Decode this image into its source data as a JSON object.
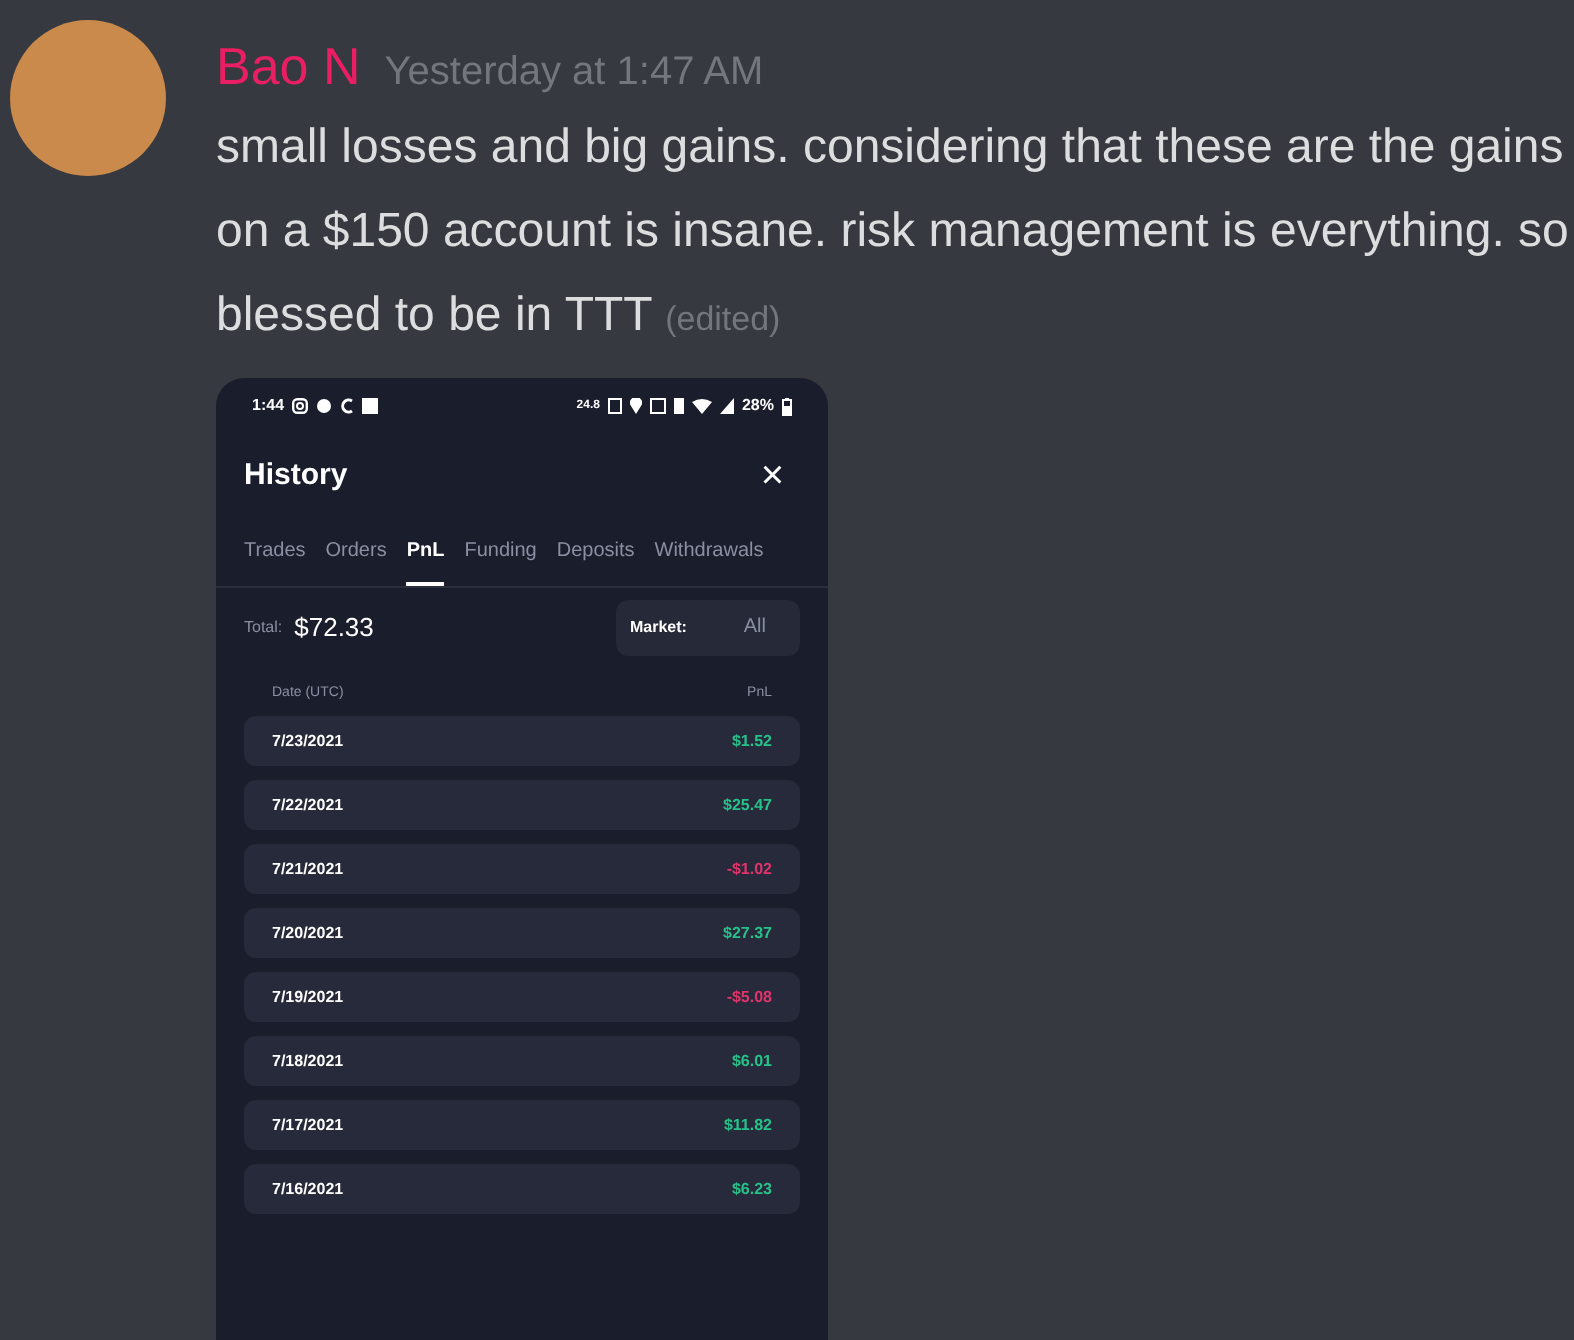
{
  "message": {
    "author": "Bao N",
    "timestamp": "Yesterday at 1:47 AM",
    "text": "small losses and big gains. considering that these are the gains on a $150 account is insane. risk management is everything. so blessed to be in TTT",
    "edited_label": "(edited)"
  },
  "attachment": {
    "status_bar": {
      "time": "1:44",
      "speed": "24.8",
      "battery": "28%"
    },
    "title": "History",
    "close": "×",
    "tabs": [
      {
        "label": "Trades",
        "selected": false
      },
      {
        "label": "Orders",
        "selected": false
      },
      {
        "label": "PnL",
        "selected": true
      },
      {
        "label": "Funding",
        "selected": false
      },
      {
        "label": "Deposits",
        "selected": false
      },
      {
        "label": "Withdrawals",
        "selected": false
      }
    ],
    "total_label": "Total:",
    "total_value": "$72.33",
    "market_label": "Market:",
    "market_value": "All",
    "columns": [
      "Date (UTC)",
      "PnL"
    ],
    "rows": [
      {
        "date": "7/23/2021",
        "pnl": "$1.52",
        "kind": "gain"
      },
      {
        "date": "7/22/2021",
        "pnl": "$25.47",
        "kind": "gain"
      },
      {
        "date": "7/21/2021",
        "pnl": "-$1.02",
        "kind": "loss"
      },
      {
        "date": "7/20/2021",
        "pnl": "$27.37",
        "kind": "gain"
      },
      {
        "date": "7/19/2021",
        "pnl": "-$5.08",
        "kind": "loss"
      },
      {
        "date": "7/18/2021",
        "pnl": "$6.01",
        "kind": "gain"
      },
      {
        "date": "7/17/2021",
        "pnl": "$11.82",
        "kind": "gain"
      },
      {
        "date": "7/16/2021",
        "pnl": "$6.23",
        "kind": "gain"
      }
    ]
  }
}
